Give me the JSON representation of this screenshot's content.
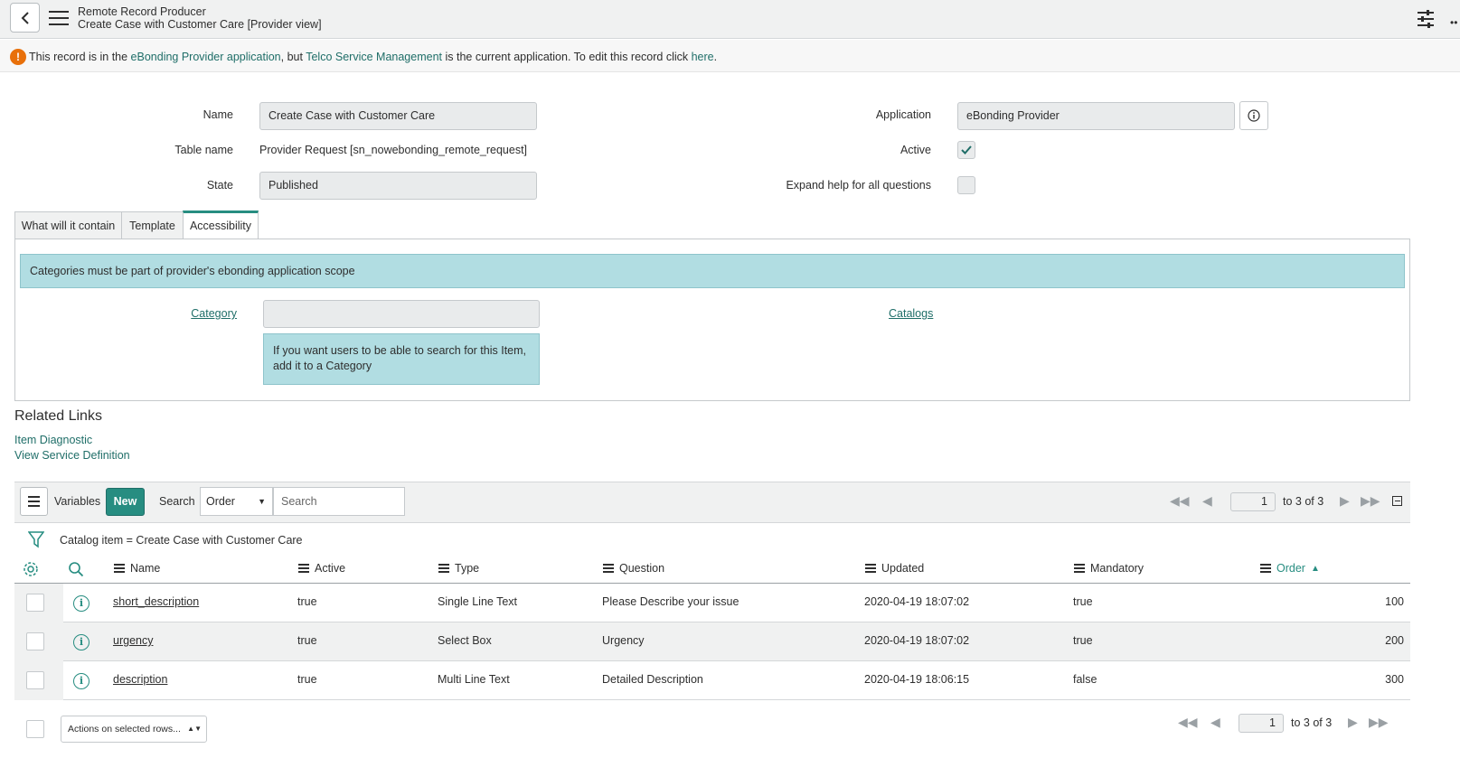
{
  "header": {
    "title": "Remote Record Producer",
    "subtitle": "Create Case with Customer Care [Provider view]"
  },
  "banner": {
    "p1": "This record is in the ",
    "app_link": "eBonding Provider application",
    "p2": ", but ",
    "current_app_link": "Telco Service Management",
    "p3": " is the current application. To edit this record click ",
    "here_link": "here",
    "p4": "."
  },
  "form": {
    "name_label": "Name",
    "name_value": "Create Case with Customer Care",
    "table_label": "Table name",
    "table_value": "Provider Request [sn_nowebonding_remote_request]",
    "state_label": "State",
    "state_value": "Published",
    "application_label": "Application",
    "application_value": "eBonding Provider",
    "active_label": "Active",
    "active_checked": true,
    "expand_label": "Expand help for all questions",
    "expand_checked": false
  },
  "tabs": [
    {
      "label": "What will it contain"
    },
    {
      "label": "Template"
    },
    {
      "label": "Accessibility",
      "active": true
    }
  ],
  "accessibility": {
    "notice": "Categories must be part of provider's ebonding application scope",
    "category_label": "Category",
    "category_value": "",
    "catalogs_label": "Catalogs",
    "help_text": "If you want users to be able to search for this Item, add it to a Category"
  },
  "related_links": {
    "title": "Related Links",
    "items": [
      "Item Diagnostic",
      "View Service Definition"
    ]
  },
  "list": {
    "title": "Variables",
    "new_label": "New",
    "search_label": "Search",
    "search_field": "Order",
    "search_placeholder": "Search",
    "page": "1",
    "page_info": "to 3 of 3",
    "filter": "Catalog item = Create Case with Customer Care",
    "columns": [
      "Name",
      "Active",
      "Type",
      "Question",
      "Updated",
      "Mandatory",
      "Order"
    ],
    "sort_column": "Order",
    "rows": [
      {
        "name": "short_description",
        "active": "true",
        "type": "Single Line Text",
        "question": "Please Describe your issue",
        "updated": "2020-04-19 18:07:02",
        "mandatory": "true",
        "order": "100"
      },
      {
        "name": "urgency",
        "active": "true",
        "type": "Select Box",
        "question": "Urgency",
        "updated": "2020-04-19 18:07:02",
        "mandatory": "true",
        "order": "200"
      },
      {
        "name": "description",
        "active": "true",
        "type": "Multi Line Text",
        "question": "Detailed Description",
        "updated": "2020-04-19 18:06:15",
        "mandatory": "false",
        "order": "300"
      }
    ],
    "actions_label": "Actions on selected rows...",
    "bottom_page": "1",
    "bottom_page_info": "to 3 of 3"
  },
  "colors": {
    "accent": "#278d81",
    "link": "#1f6e68",
    "warning": "#e8700a",
    "info_bg": "#b1dde2"
  }
}
